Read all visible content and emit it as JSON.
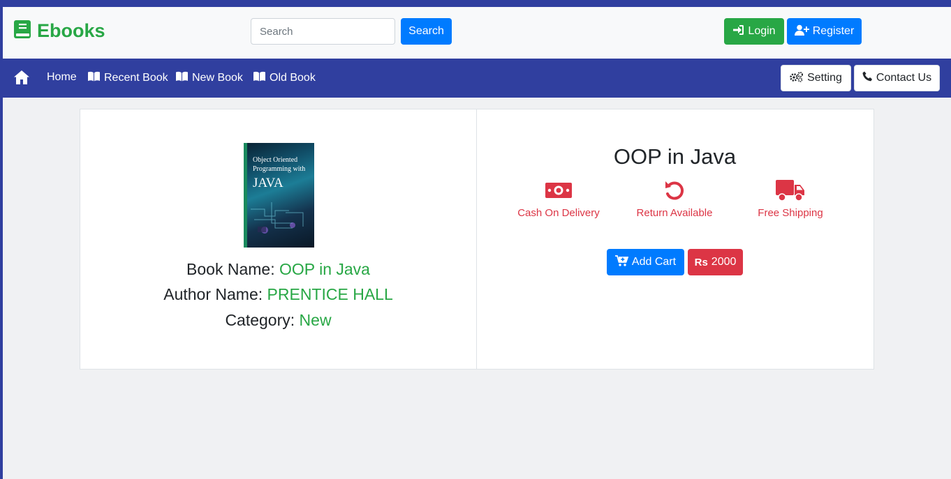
{
  "header": {
    "brand": "Ebooks",
    "search_placeholder": "Search",
    "search_button": "Search",
    "login": "Login",
    "register": "Register"
  },
  "nav": {
    "home": "Home",
    "recent": "Recent Book",
    "new": "New Book",
    "old": "Old Book",
    "setting": "Setting",
    "contact": "Contact Us"
  },
  "book": {
    "cover_lines": [
      "Object Oriented",
      "Programming with",
      "JAVA"
    ],
    "name_label": "Book Name:",
    "name": "OOP in Java",
    "author_label": "Author Name:",
    "author": "PRENTICE HALL",
    "category_label": "Category:",
    "category": "New"
  },
  "product": {
    "title": "OOP in Java",
    "features": [
      "Cash On Delivery",
      "Return Available",
      "Free Shipping"
    ],
    "add_cart": "Add Cart",
    "currency_symbol": "Rs",
    "price": "2000"
  },
  "colors": {
    "navbar": "#303f9f",
    "brand": "#28a745",
    "primary": "#007bff",
    "danger": "#dc3545"
  }
}
